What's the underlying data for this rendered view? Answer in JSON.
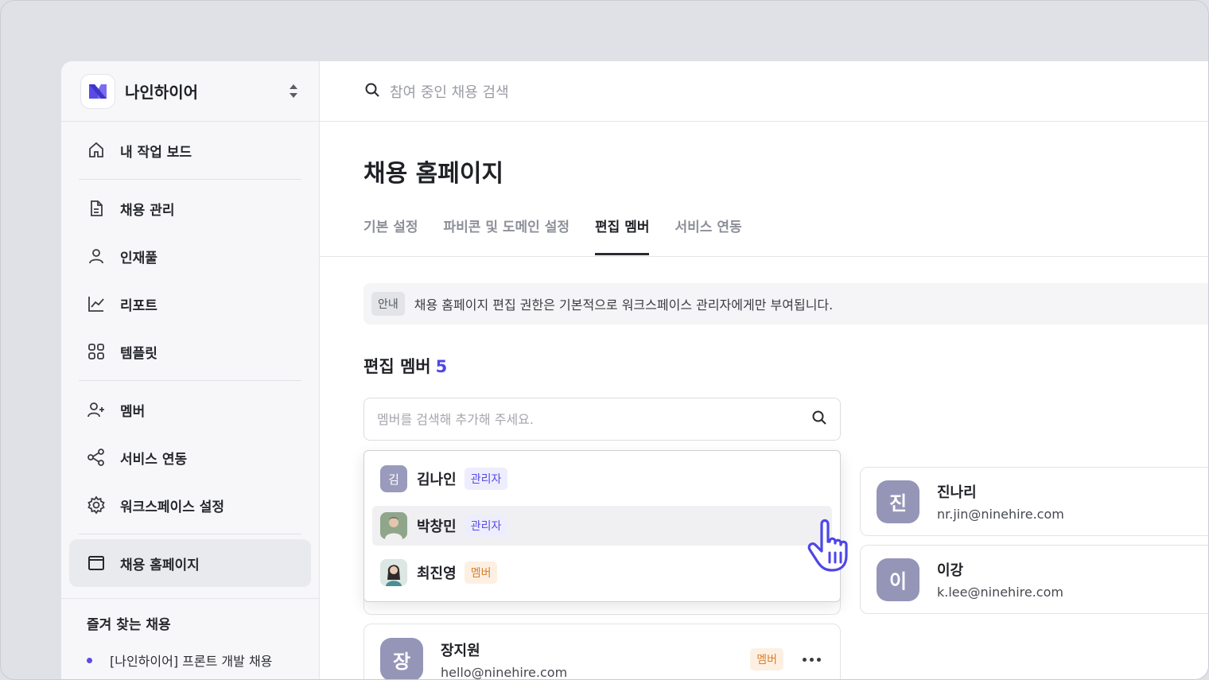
{
  "workspace": {
    "name": "나인하이어"
  },
  "search": {
    "placeholder": "참여 중인 채용 검색"
  },
  "sidebar": {
    "items": [
      {
        "label": "내 작업 보드",
        "icon": "home-icon"
      },
      {
        "label": "채용 관리",
        "icon": "document-icon"
      },
      {
        "label": "인재풀",
        "icon": "person-icon"
      },
      {
        "label": "리포트",
        "icon": "chart-icon"
      },
      {
        "label": "템플릿",
        "icon": "grid-icon"
      },
      {
        "label": "멤버",
        "icon": "add-user-icon"
      },
      {
        "label": "서비스 연동",
        "icon": "share-icon"
      },
      {
        "label": "워크스페이스 설정",
        "icon": "gear-icon"
      },
      {
        "label": "채용 홈페이지",
        "icon": "window-icon"
      }
    ],
    "favorites_title": "즐겨 찾는 채용",
    "favorites": [
      "[나인하이어] 프론트 개발 채용"
    ]
  },
  "page": {
    "title": "채용 홈페이지",
    "tabs": [
      "기본 설정",
      "파비콘 및 도메인 설정",
      "편집 멤버",
      "서비스 연동"
    ],
    "active_tab": "편집 멤버"
  },
  "notice": {
    "badge": "안내",
    "text": "채용 홈페이지 편집 권한은 기본적으로 워크스페이스 관리자에게만 부여됩니다."
  },
  "members_section": {
    "title": "편집 멤버",
    "count": "5",
    "search_placeholder": "멤버를 검색해 추가해 주세요."
  },
  "dropdown": [
    {
      "initial": "김",
      "name": "김나인",
      "role": "관리자"
    },
    {
      "name": "박창민",
      "role": "관리자"
    },
    {
      "name": "최진영",
      "role": "멤버"
    }
  ],
  "members": [
    {
      "initial": "진",
      "name": "진나리",
      "email": "nr.jin@ninehire.com"
    },
    {
      "initial": "이",
      "name": "이강",
      "email": "k.lee@ninehire.com"
    },
    {
      "initial": "장",
      "name": "장지원",
      "email": "hello@ninehire.com",
      "role": "멤버"
    }
  ],
  "colors": {
    "accent": "#4e46e5",
    "admin_tag": "#5b4be6",
    "member_tag": "#d9802c",
    "avatar": "#9595b8"
  }
}
